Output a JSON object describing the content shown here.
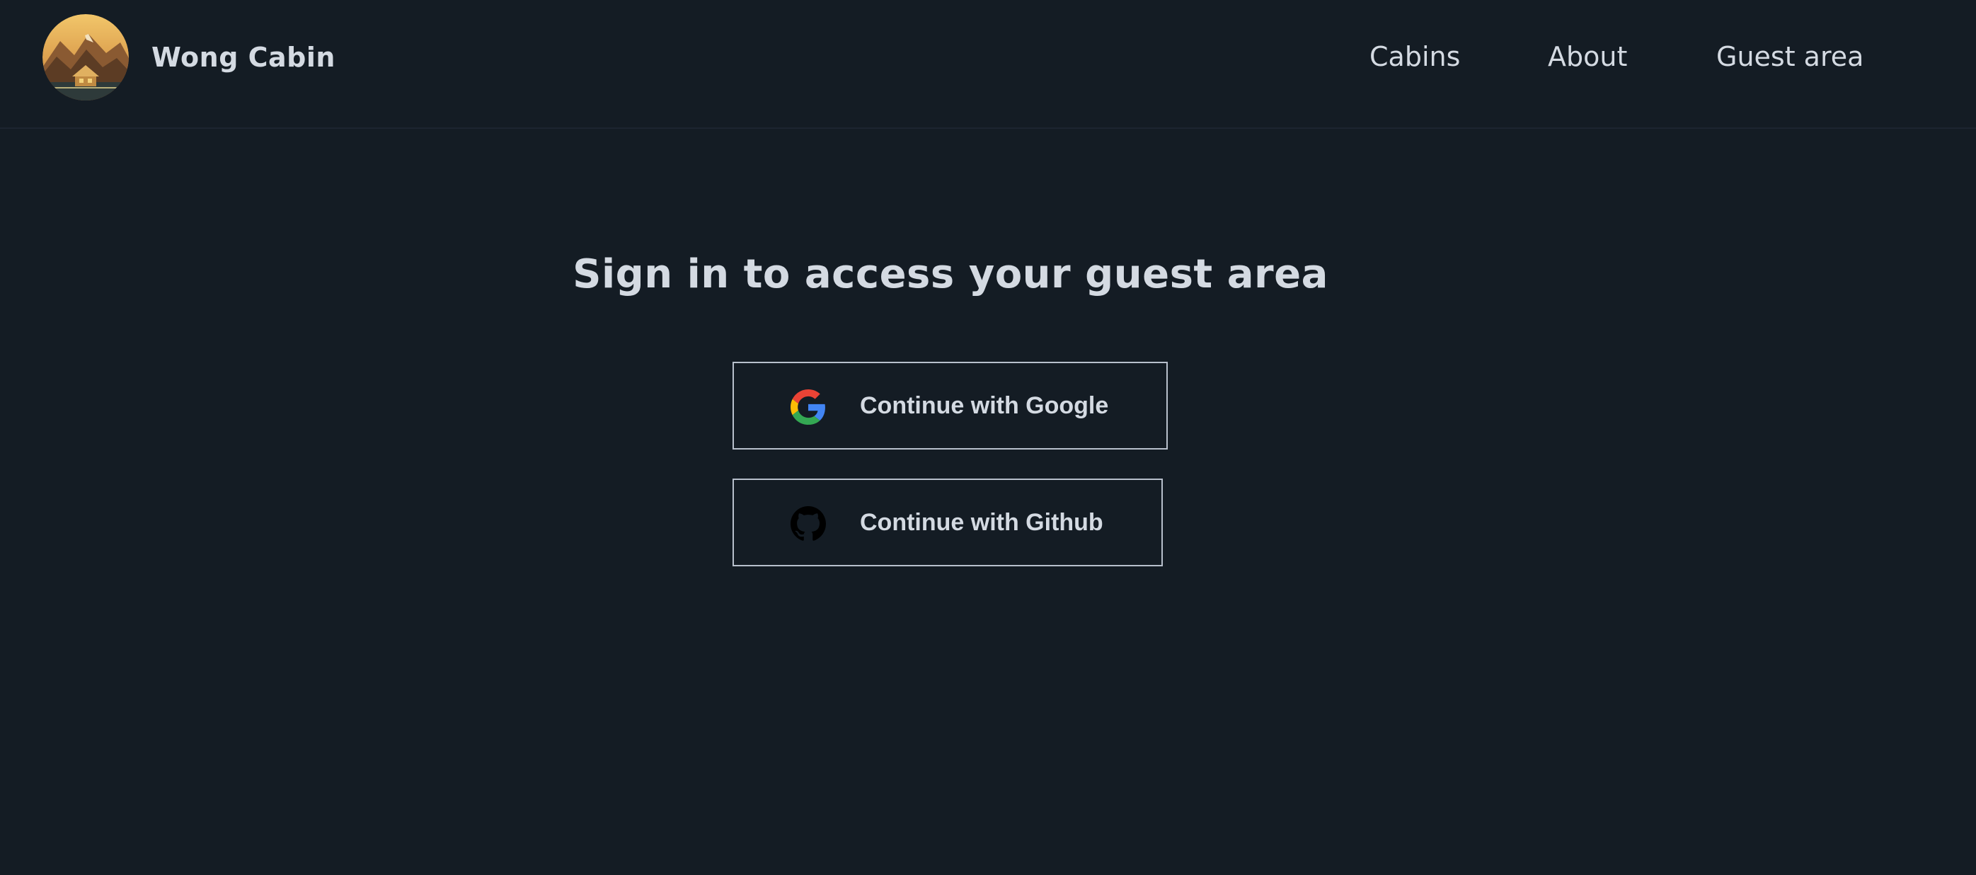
{
  "header": {
    "brand": "Wong Cabin",
    "nav": {
      "cabins": "Cabins",
      "about": "About",
      "guest_area": "Guest area"
    }
  },
  "main": {
    "title": "Sign in to access your guest area",
    "google_button": "Continue with Google",
    "github_button": "Continue with Github"
  },
  "icons": {
    "logo": "mountain-cabin-logo",
    "google": "google-icon",
    "github": "github-icon"
  },
  "colors": {
    "background": "#141c24",
    "text": "#d4dae2",
    "border": "#b8c0cc"
  }
}
